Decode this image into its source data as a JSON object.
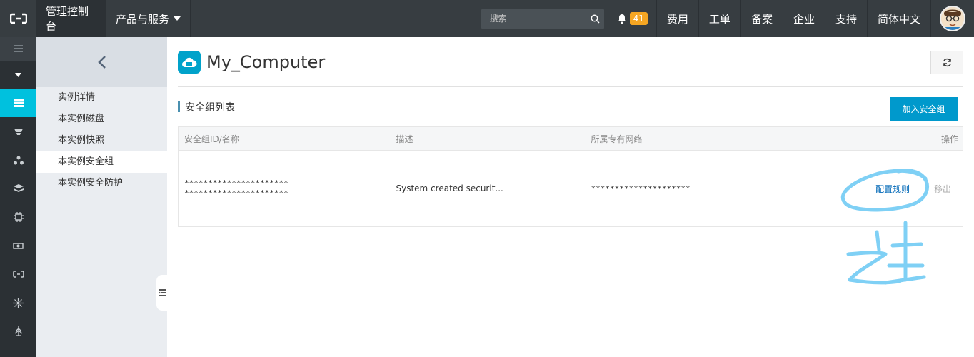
{
  "topbar": {
    "console": "管理控制台",
    "products": "产品与服务",
    "search_placeholder": "搜索",
    "notification_count": "41",
    "links": [
      "费用",
      "工单",
      "备案",
      "企业",
      "支持",
      "简体中文"
    ]
  },
  "subnav": {
    "items": [
      "实例详情",
      "本实例磁盘",
      "本实例快照",
      "本实例安全组",
      "本实例安全防护"
    ],
    "active_index": 3
  },
  "main": {
    "title": "My_Computer",
    "section_title": "安全组列表",
    "add_button": "加入安全组",
    "table": {
      "headers": [
        "安全组ID/名称",
        "描述",
        "所属专有网络",
        "操作"
      ],
      "rows": [
        {
          "id": "**********************",
          "name": "**********************",
          "description": "System created securit...",
          "vpc": "*********************",
          "action_config": "配置规则",
          "action_remove": "移出"
        }
      ]
    }
  },
  "colors": {
    "accent": "#00c1de",
    "topbar": "#373d41",
    "rail": "#2b3034",
    "button": "#0099cc",
    "annotation": "#7fd0f5"
  }
}
